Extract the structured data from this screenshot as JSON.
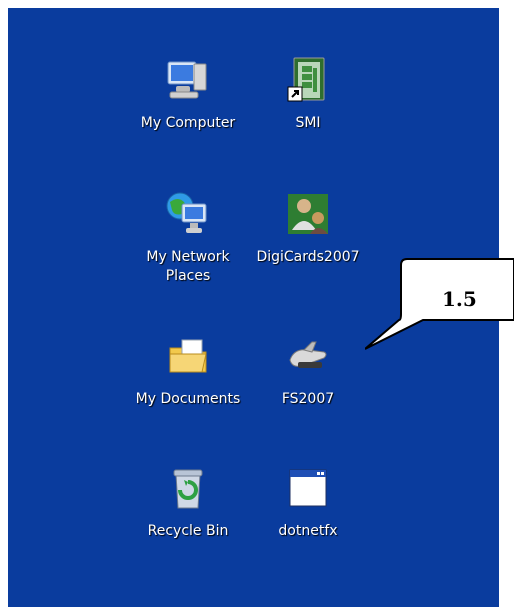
{
  "desktop": {
    "background_color": "#0a3c9e",
    "icons": [
      {
        "label": "My Computer",
        "icon": "my-computer-icon"
      },
      {
        "label": "SMI",
        "icon": "smi-shortcut-icon"
      },
      {
        "label": "My Network",
        "label2": "Places",
        "icon": "my-network-places-icon"
      },
      {
        "label": "DigiCards2007",
        "icon": "digicards-icon"
      },
      {
        "label": "My Documents",
        "icon": "my-documents-icon"
      },
      {
        "label": "FS2007",
        "icon": "fs2007-icon"
      },
      {
        "label": "Recycle Bin",
        "icon": "recycle-bin-icon"
      },
      {
        "label": "dotnetfx",
        "icon": "dotnetfx-icon"
      }
    ]
  },
  "callout": {
    "text": "1.5"
  }
}
